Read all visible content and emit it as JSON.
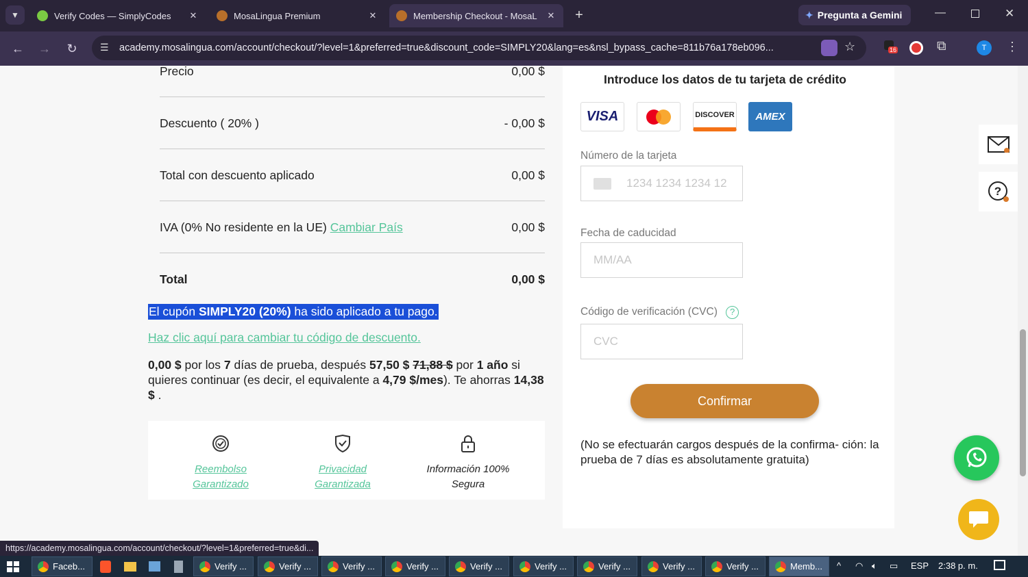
{
  "browser": {
    "tabs": [
      {
        "title": "Verify Codes — SimplyCodes",
        "active": false
      },
      {
        "title": "MosaLingua Premium",
        "active": false
      },
      {
        "title": "Membership Checkout - MosaL",
        "active": true
      }
    ],
    "gemini_label": "Pregunta a Gemini",
    "url": "academy.mosalingua.com/account/checkout/?level=1&preferred=true&discount_code=SIMPLY20&lang=es&nsl_bypass_cache=811b76a178eb096...",
    "extension_badge": "16",
    "profile_initial": "T"
  },
  "summary": {
    "rows": [
      {
        "label": "Precio",
        "value": "0,00 $"
      },
      {
        "label": "Descuento ( 20% )",
        "value": "- 0,00 $"
      },
      {
        "label": "Total con descuento aplicado",
        "value": "0,00 $"
      },
      {
        "label": "IVA (0% No residente en la UE)",
        "link": "Cambiar País",
        "value": "0,00 $"
      },
      {
        "label": "Total",
        "value": "0,00 $"
      }
    ],
    "coupon_prefix": "El cupón ",
    "coupon_code": "SIMPLY20 (20%)",
    "coupon_suffix": " ha sido aplicado a tu pago.",
    "change_link": "Haz clic aquí para cambiar tu código de descuento.",
    "trial": {
      "p1": "0,00 $",
      "t1": " por los ",
      "p2": "7",
      "t2": " días de prueba, después ",
      "p3": "57,50 $",
      "strike": "71,88 $",
      "t3": " por ",
      "p4": "1 año",
      "t4": " si quieres continuar (es decir, el equivalente a ",
      "p5": "4,79 $/mes",
      "t5": "). Te ahorras ",
      "p6": "14,38 $",
      "t6": " ."
    },
    "guarantees": [
      {
        "line1": "Reembolso",
        "line2": "Garantizado",
        "icon": "check-badge-icon"
      },
      {
        "line1": "Privacidad",
        "line2": "Garantizada",
        "icon": "shield-check-icon"
      },
      {
        "line1": "Información 100%",
        "line2": "Segura",
        "icon": "lock-icon"
      }
    ]
  },
  "payment": {
    "heading": "Introduce los datos de tu tarjeta de crédito",
    "cards": [
      "VISA",
      "Mastercard",
      "DISCOVER",
      "AMEX"
    ],
    "card_number_label": "Número de la tarjeta",
    "card_number_placeholder": "1234 1234 1234 12",
    "expiry_label": "Fecha de caducidad",
    "expiry_placeholder": "MM/AA",
    "cvc_label": "Código de verificación (CVC)",
    "cvc_placeholder": "CVC",
    "confirm_label": "Confirmar",
    "note": "(No se efectuarán cargos después de la confirma- ción: la prueba de 7 días es absolutamente gratuita)"
  },
  "status_url": "https://academy.mosalingua.com/account/checkout/?level=1&preferred=true&di...",
  "taskbar": {
    "items": [
      "Faceb...",
      "Verify ...",
      "Verify ...",
      "Verify ...",
      "Verify ...",
      "Verify ...",
      "Verify ...",
      "Verify ...",
      "Verify ...",
      "Verify ...",
      "Memb..."
    ],
    "lang": "ESP",
    "time": "2:38 p. m."
  },
  "colors": {
    "accent_green": "#55c59a",
    "confirm_orange": "#c98230",
    "whatsapp": "#27c75c"
  }
}
